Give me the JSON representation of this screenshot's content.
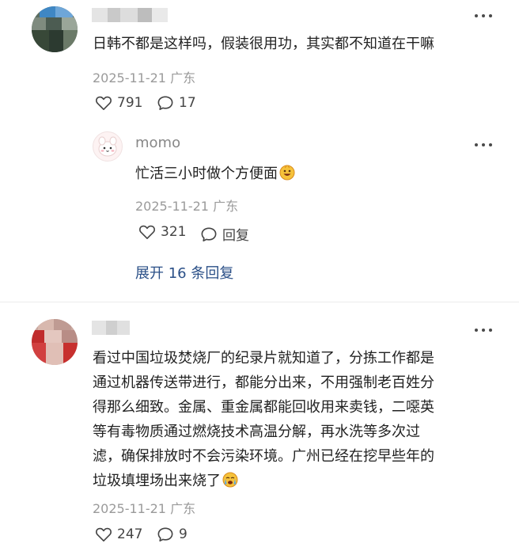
{
  "comments": [
    {
      "text": "日韩不都是这样吗，假装很用功，其实都不知道在干嘛",
      "meta": "2025-11-21 广东",
      "likes": "791",
      "replies": "17"
    },
    {
      "username": "momo",
      "text": "忙活三小时做个方便面",
      "meta": "2025-11-21 广东",
      "likes": "321",
      "reply_label": "回复"
    },
    {
      "lines": [
        "看过中国垃圾焚烧厂的纪录片就知道了，分拣工作都是",
        "通过机器传送带进行，都能分出来，不用强制老百姓分",
        "得那么细致。金属、重金属都能回收用来卖钱，二噁英",
        "等有毒物质通过燃烧技术高温分解，再水洗等多次过",
        "滤，确保排放时不会污染环境。广州已经在挖早些年的",
        "垃圾填埋场出来烧了"
      ],
      "meta": "2025-11-21 广东",
      "likes": "247",
      "replies": "9"
    }
  ],
  "expand_replies": "展开 16 条回复",
  "icons": {
    "like": "heart-outline-icon",
    "comment": "speech-bubble-icon",
    "more": "more-dots-icon",
    "emoji_1": "grinning-face-emoji",
    "emoji_2": "crying-face-emoji"
  },
  "colors": {
    "link": "#2a4f87",
    "meta": "#9a9a9a"
  }
}
